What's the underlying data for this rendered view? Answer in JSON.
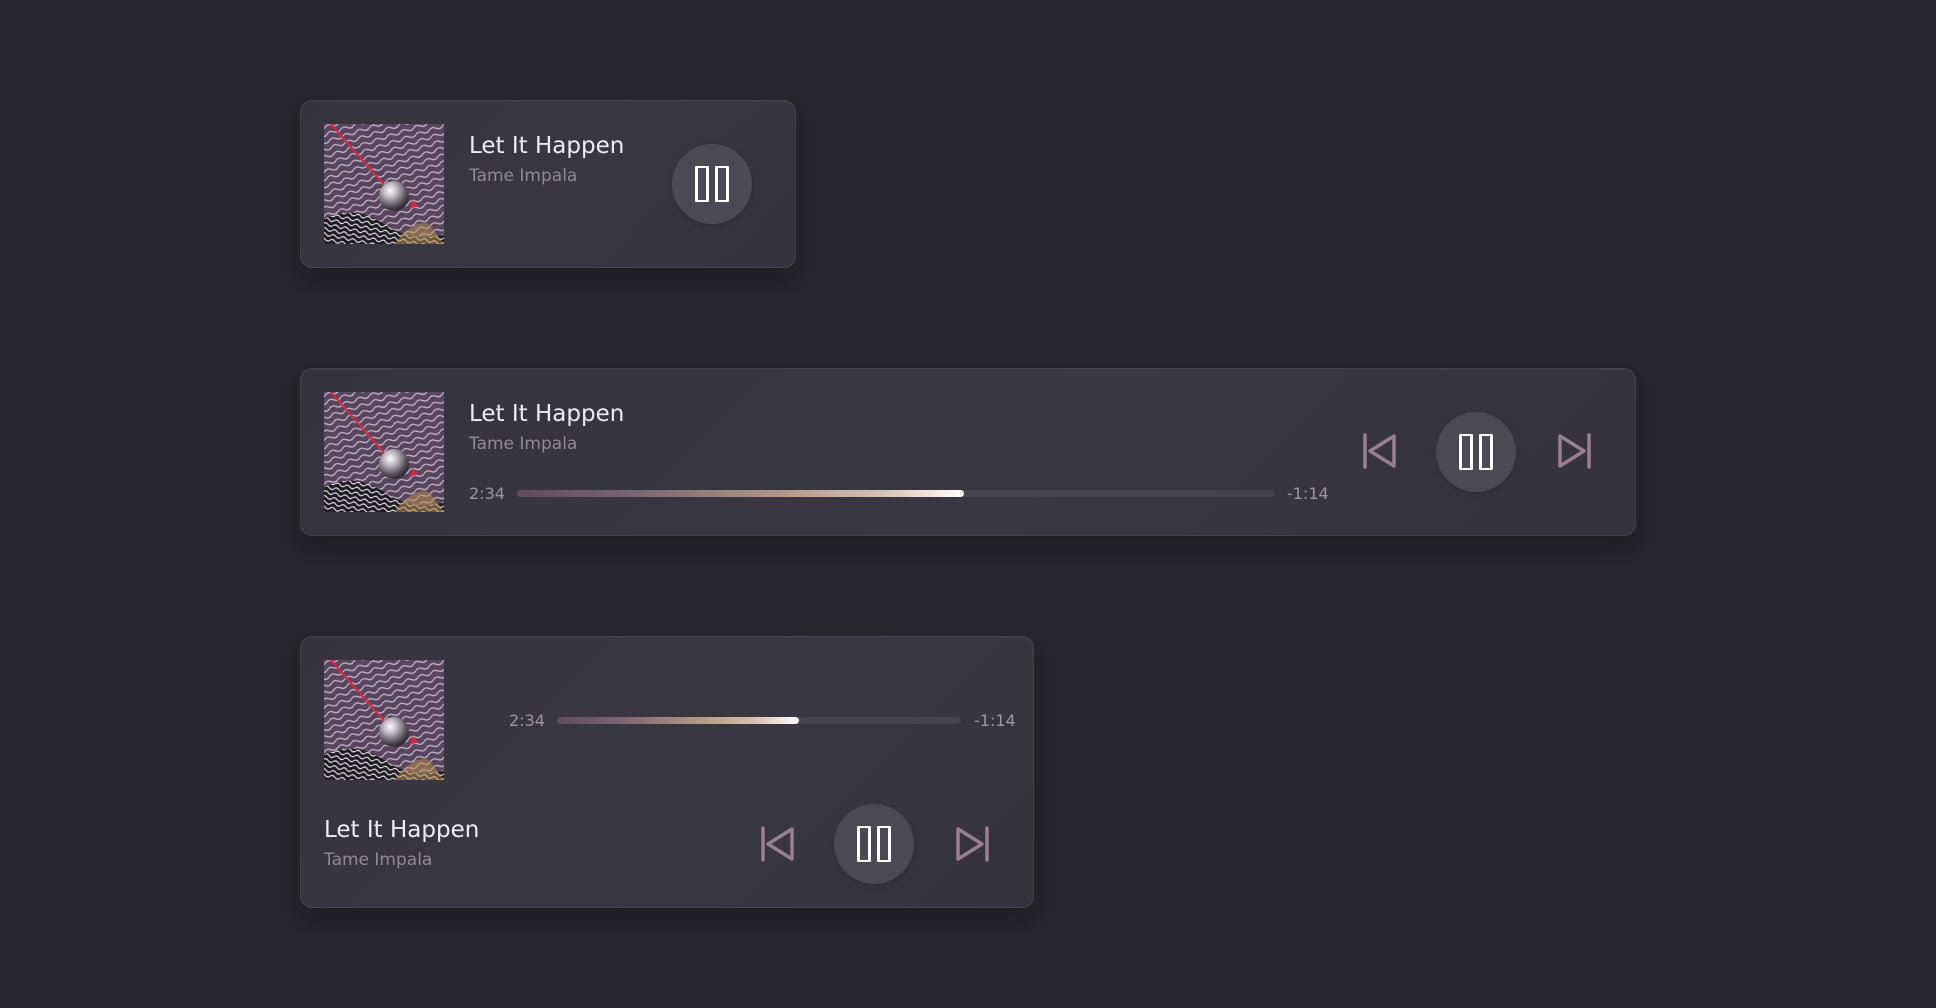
{
  "track": {
    "title": "Let It Happen",
    "artist": "Tame Impala",
    "elapsed": "2:34",
    "remaining": "-1:14"
  },
  "players": {
    "compact": {
      "progress": null
    },
    "wide": {
      "progress": 0.59
    },
    "stacked": {
      "progress": 0.6
    }
  },
  "icons": {
    "pause": "pause-icon",
    "previous": "skip-previous-icon",
    "next": "skip-next-icon"
  },
  "colors": {
    "background": "#27272d",
    "card": "#37353f",
    "pause_button": "#4b4953",
    "skip_icon": "#9a7f94",
    "title": "#eeedf2",
    "artist": "#8e8a98"
  }
}
